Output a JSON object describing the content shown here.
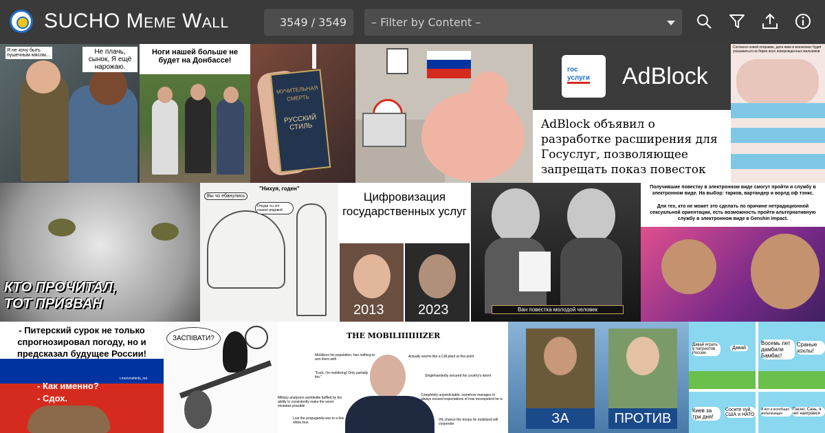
{
  "header": {
    "title": "SUCHO Meme Wall",
    "counter": "3549 / 3549",
    "filter_placeholder": "– Filter by Content –",
    "icons": [
      "search-icon",
      "filter-icon",
      "upload-icon",
      "info-icon"
    ]
  },
  "memes": {
    "m1": {
      "caption_left": "Я не хочу быть пушечным мясом...",
      "caption_right": "Не плачь, сынок, Я ещё нарожаю."
    },
    "m2": {
      "caption": "Ноги нашей больше не будет на Донбассе!"
    },
    "m3": {
      "pack_line1": "МУЧИТЕЛЬНАЯ",
      "pack_line2": "СМЕРТЬ",
      "pack_line3": "РУССКИЙ СТИЛЬ"
    },
    "m5": {
      "logo_text_line1": "гос",
      "logo_text_line2": "услуги",
      "logo": "AdBlock",
      "caption": "AdBlock объявил о разработке расширения для Госуслуг, позволяющее запрещать показ повесток"
    },
    "m6": {
      "caption": "Согласно новой поправке, дата явки в военкомат будет указываться на бирке всех новорожденных мальчиков"
    },
    "m7": {
      "caption": "КТО ПРОЧИТАЛ, ТОТ ПРИЗВАН"
    },
    "m8": {
      "bubble1": "Вы чо ебанулись",
      "bubble2": "\"Нихуя, годен\"",
      "bubble3": "Откуда ты это снизил рядовой"
    },
    "m9": {
      "title": "Цифровизация государственных услуг",
      "year_left": "2013",
      "year_right": "2023"
    },
    "m10": {
      "caption": "Ван повестка молодой человек"
    },
    "m11": {
      "text1": "Получившие повестку в электронном виде смогут пройти и службу в электронном виде. На выбор: тарков, вартандер и ворлд оф тэнкс.",
      "text2": "Для тех, кто не может это сделать по причине нетрадиционной сексуальной ориентации, есть возможность пройти альтернативную службу в электронном виде в Genshin Impact."
    },
    "m12": {
      "text": "- Питерский сурок не только спрогнозировал погоду, но и предсказал будущее России!",
      "q1": "- Как именно?",
      "q2": "- Сдох.",
      "watermark": "t.me/vmshinki_net"
    },
    "m13": {
      "bubble": "ЗАСПІВАТИ?"
    },
    "m14": {
      "title": "THE MOBILIIIIIIIZER",
      "notes": [
        "Mobilizes his population, has nothing to arm them with",
        "Actually seems like a CIA plant at this point",
        "\"Fuck, I'm mobilizing! Only partially tho.\"",
        "Singlehandedly secured his country's doom",
        "Military analyzers worldwide baffled by his ability to consistently make the worst mistakes possible",
        "Completely unpredictable, somehow manages to always exceed expectations of how incompetent he is",
        "Lost the propaganda war to a few shiba inus",
        "0% chance the troops he mobilized will cooperate"
      ]
    },
    "m15": {
      "label_left": "ЗА",
      "label_right": "ПРОТИВ"
    },
    "m16": {
      "b1": "Давай играть в патриотов России",
      "b2": "Давай",
      "b3": "Восемь лет дамбили Бамбас!",
      "b4": "Сраные хохлы!",
      "b5": "Киев за три дня!",
      "b6": "Сосите хуй, США и НАТО",
      "b7": "А вот и всеобщая мобилизация",
      "b8": "Пасно, Сань, я чет наиграмся"
    }
  },
  "colors": {
    "topbar": "#3a3a3a",
    "field": "#4d4d4d",
    "accent_blue": "#1d6fc4",
    "russia_red": "#d52b1e"
  }
}
